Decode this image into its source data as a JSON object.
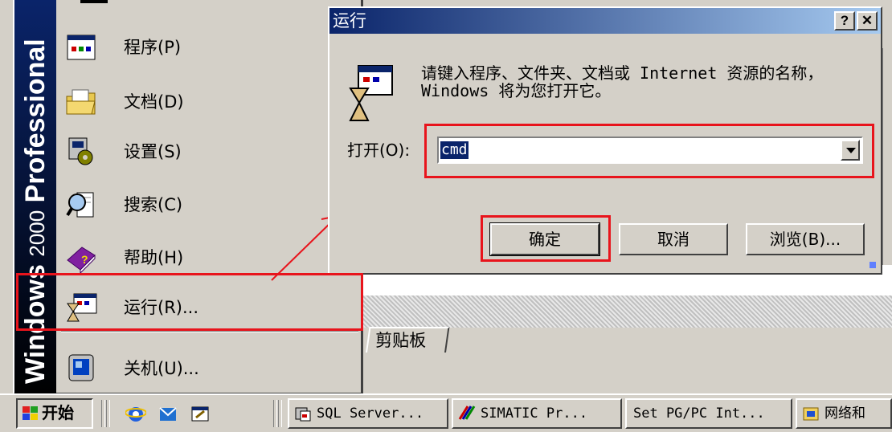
{
  "start_menu": {
    "banner": {
      "brand": "Windows",
      "version": "2000",
      "edition": "Professional"
    },
    "items": [
      {
        "label": "程序(P)",
        "icon": "programs-icon"
      },
      {
        "label": "文档(D)",
        "icon": "documents-icon"
      },
      {
        "label": "设置(S)",
        "icon": "settings-icon"
      },
      {
        "label": "搜索(C)",
        "icon": "search-icon"
      },
      {
        "label": "帮助(H)",
        "icon": "help-icon"
      },
      {
        "label": "运行(R)...",
        "icon": "run-icon"
      },
      {
        "label": "关机(U)...",
        "icon": "shutdown-icon"
      }
    ]
  },
  "run_dialog": {
    "title": "运行",
    "help_button": "?",
    "close_button": "✕",
    "prompt": "请键入程序、文件夹、文档或 Internet 资源的名称，Windows 将为您打开它。",
    "open_label": "打开(O):",
    "open_value": "cmd",
    "ok_label": "确定",
    "cancel_label": "取消",
    "browse_label": "浏览(B)..."
  },
  "background": {
    "clipboard_tab": "剪贴板"
  },
  "taskbar": {
    "start_label": "开始",
    "tasks": [
      {
        "label": "SQL Server...",
        "icon": "sql-server-icon"
      },
      {
        "label": "SIMATIC Pr...",
        "icon": "simatic-icon"
      },
      {
        "label": "Set PG/PC Int...",
        "icon": ""
      },
      {
        "label": "网络和",
        "icon": "network-folder-icon"
      }
    ]
  },
  "colors": {
    "annotation_red": "#e8141c",
    "title_bar": "#0a246a",
    "face": "#d4d0c8"
  }
}
